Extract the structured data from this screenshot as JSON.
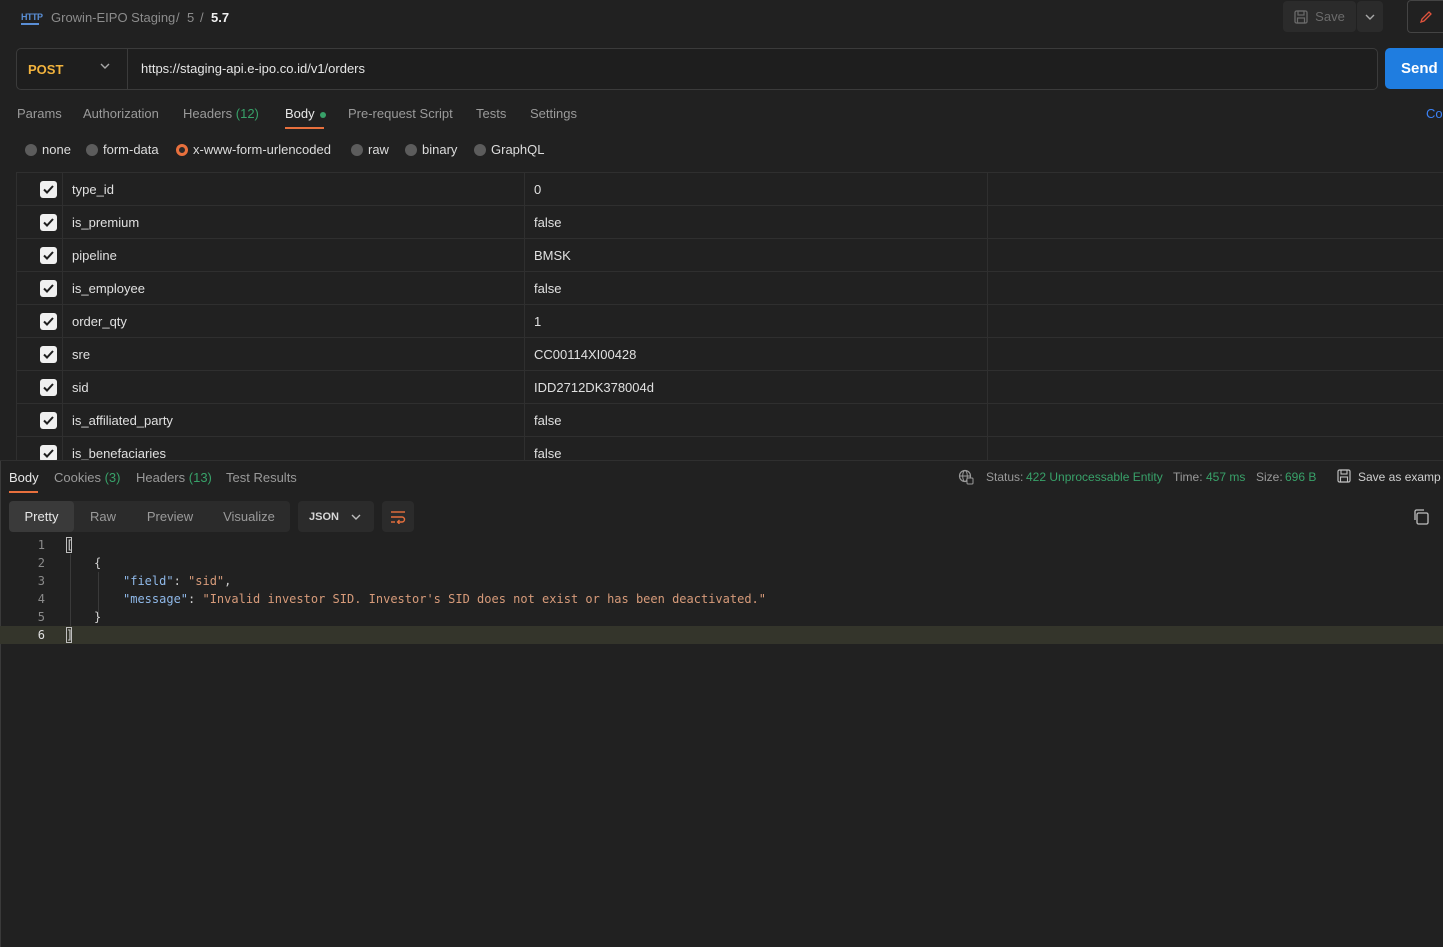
{
  "breadcrumb": {
    "collection": "Growin-EIPO Staging",
    "sep1": "/",
    "folder": "5",
    "sep2": "/",
    "request": "5.7"
  },
  "toolbar": {
    "save_label": "Save"
  },
  "request": {
    "method": "POST",
    "url": "https://staging-api.e-ipo.co.id/v1/orders",
    "send_label": "Send"
  },
  "request_tabs": {
    "params": "Params",
    "authorization": "Authorization",
    "headers": "Headers",
    "headers_count": "(12)",
    "body": "Body",
    "prerequest": "Pre-request Script",
    "tests": "Tests",
    "settings": "Settings",
    "cookies_partial": "Co"
  },
  "body_types": [
    "none",
    "form-data",
    "x-www-form-urlencoded",
    "raw",
    "binary",
    "GraphQL"
  ],
  "body_type_selected": "x-www-form-urlencoded",
  "form_fields": [
    {
      "key": "type_id",
      "value": "0"
    },
    {
      "key": "is_premium",
      "value": "false"
    },
    {
      "key": "pipeline",
      "value": "BMSK"
    },
    {
      "key": "is_employee",
      "value": "false"
    },
    {
      "key": "order_qty",
      "value": "1"
    },
    {
      "key": "sre",
      "value": "CC00114XI00428"
    },
    {
      "key": "sid",
      "value": "IDD2712DK378004d"
    },
    {
      "key": "is_affiliated_party",
      "value": "false"
    },
    {
      "key": "is_benefaciaries",
      "value": "false"
    }
  ],
  "response_tabs": {
    "body": "Body",
    "cookies": "Cookies",
    "cookies_count": "(3)",
    "headers": "Headers",
    "headers_count": "(13)",
    "test_results": "Test Results"
  },
  "response_meta": {
    "status_label": "Status:",
    "status_value": "422 Unprocessable Entity",
    "time_label": "Time:",
    "time_value": "457 ms",
    "size_label": "Size:",
    "size_value": "696 B",
    "save_example": "Save as examp"
  },
  "view_modes": {
    "pretty": "Pretty",
    "raw": "Raw",
    "preview": "Preview",
    "visualize": "Visualize",
    "format": "JSON"
  },
  "response_body": {
    "line_numbers": [
      "1",
      "2",
      "3",
      "4",
      "5",
      "6"
    ],
    "open_bracket": "[",
    "open_brace": "{",
    "field_key": "\"field\"",
    "field_value": "\"sid\"",
    "message_key": "\"message\"",
    "message_value": "\"Invalid investor SID. Investor's SID does not exist or has been deactivated.\"",
    "close_brace": "}",
    "close_bracket": "]"
  },
  "colors": {
    "accent": "#e8703d",
    "method": "#f2b33d",
    "send": "#1f7de0",
    "status_ok": "#38a169"
  }
}
